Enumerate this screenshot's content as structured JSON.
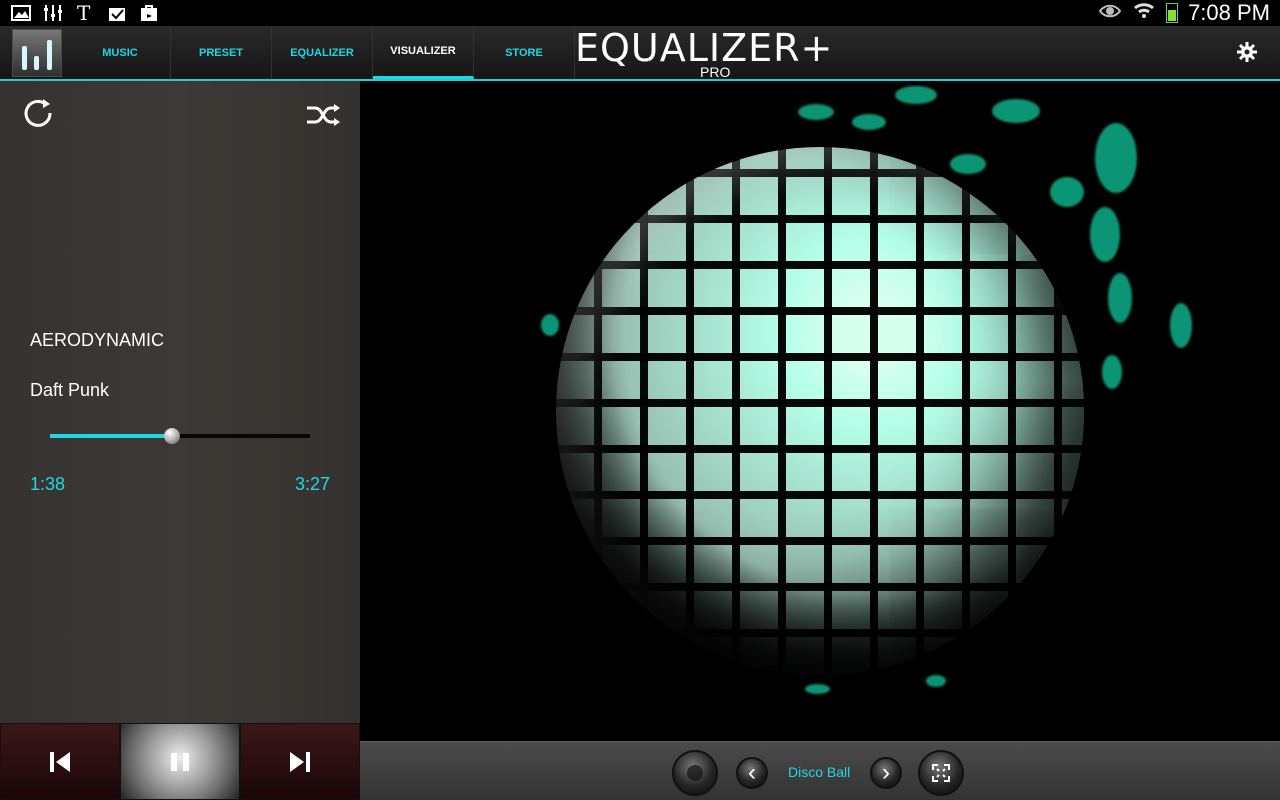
{
  "status": {
    "time": "7:08 PM",
    "left_icons": [
      "image-icon",
      "equalizer-icon",
      "newspaper-icon",
      "checkmark-bag-icon",
      "shopping-bag-icon"
    ],
    "right_icons": [
      "eye-icon",
      "wifi-icon",
      "battery-icon"
    ]
  },
  "header": {
    "tabs": [
      "MUSIC",
      "PRESET",
      "EQUALIZER",
      "VISUALIZER",
      "STORE"
    ],
    "active_tab": "VISUALIZER",
    "brand": "EQUALIZER+",
    "brand_sub": "PRO",
    "settings_icon": "gear-icon"
  },
  "player": {
    "title": "AERODYNAMIC",
    "artist": "Daft Punk",
    "elapsed": "1:38",
    "duration": "3:27",
    "progress_fraction": 0.47,
    "repeat_icon": "repeat-icon",
    "shuffle_icon": "shuffle-icon"
  },
  "visualizer": {
    "preset": "Disco Ball",
    "accent": "#0ea681"
  },
  "colors": {
    "accent": "#20d7e6",
    "panel": "#3a3633"
  }
}
